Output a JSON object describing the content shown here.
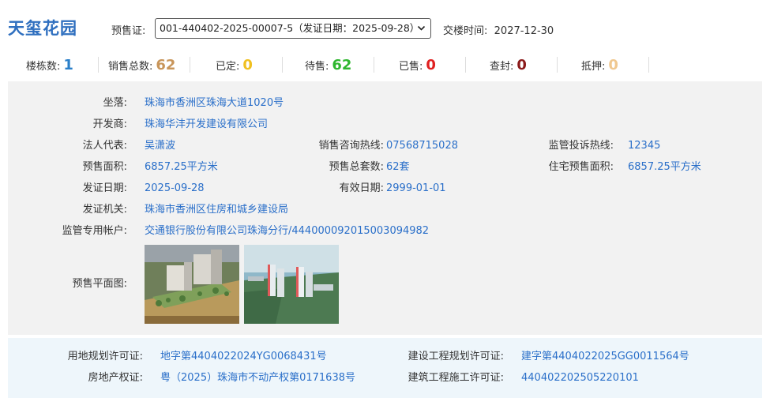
{
  "header": {
    "title": "天玺花园",
    "presale_label": "预售证:",
    "presale_selected": "001-440402-2025-00007-5（发证日期：2025-09-28）",
    "delivery_label": "交楼时间:",
    "delivery_value": "2027-12-30"
  },
  "stats": [
    {
      "label": "楼栋数:",
      "value": "1",
      "color": "#2a7fc9"
    },
    {
      "label": "销售总数:",
      "value": "62",
      "color": "#c8955a"
    },
    {
      "label": "已定:",
      "value": "0",
      "color": "#f0c020"
    },
    {
      "label": "待售:",
      "value": "62",
      "color": "#2eb62e"
    },
    {
      "label": "已售:",
      "value": "0",
      "color": "#e02020"
    },
    {
      "label": "查封:",
      "value": "0",
      "color": "#8b1a1a"
    },
    {
      "label": "抵押:",
      "value": "0",
      "color": "#f0c890"
    }
  ],
  "info": {
    "location_label": "坐落:",
    "location": "珠海市香洲区珠海大道1020号",
    "developer_label": "开发商:",
    "developer": "珠海华沣开发建设有限公司",
    "legal_rep_label": "法人代表:",
    "legal_rep": "吴潇波",
    "sales_hotline_label": "销售咨询热线:",
    "sales_hotline": "07568715028",
    "complaint_label": "监管投诉热线:",
    "complaint": "12345",
    "presale_area_label": "预售面积:",
    "presale_area": "6857.25平方米",
    "presale_units_label": "预售总套数:",
    "presale_units": "62套",
    "residential_area_label": "住宅预售面积:",
    "residential_area": "6857.25平方米",
    "issue_date_label": "发证日期:",
    "issue_date": "2025-09-28",
    "valid_date_label": "有效日期:",
    "valid_date": "2999-01-01",
    "issuer_label": "发证机关:",
    "issuer": "珠海市香洲区住房和城乡建设局",
    "account_label": "监管专用帐户:",
    "account": "交通银行股份有限公司珠海分行/444000092015003094982",
    "floorplan_label": "预售平面图:"
  },
  "license": {
    "land_plan_label": "用地规划许可证:",
    "land_plan": "地字第4404022024YG0068431号",
    "build_plan_label": "建设工程规划许可证:",
    "build_plan": "建字第4404022025GG0011564号",
    "property_label": "房地产权证:",
    "property": "粤（2025）珠海市不动产权第0171638号",
    "construction_label": "建筑工程施工许可证:",
    "construction": "440402202505220101"
  }
}
